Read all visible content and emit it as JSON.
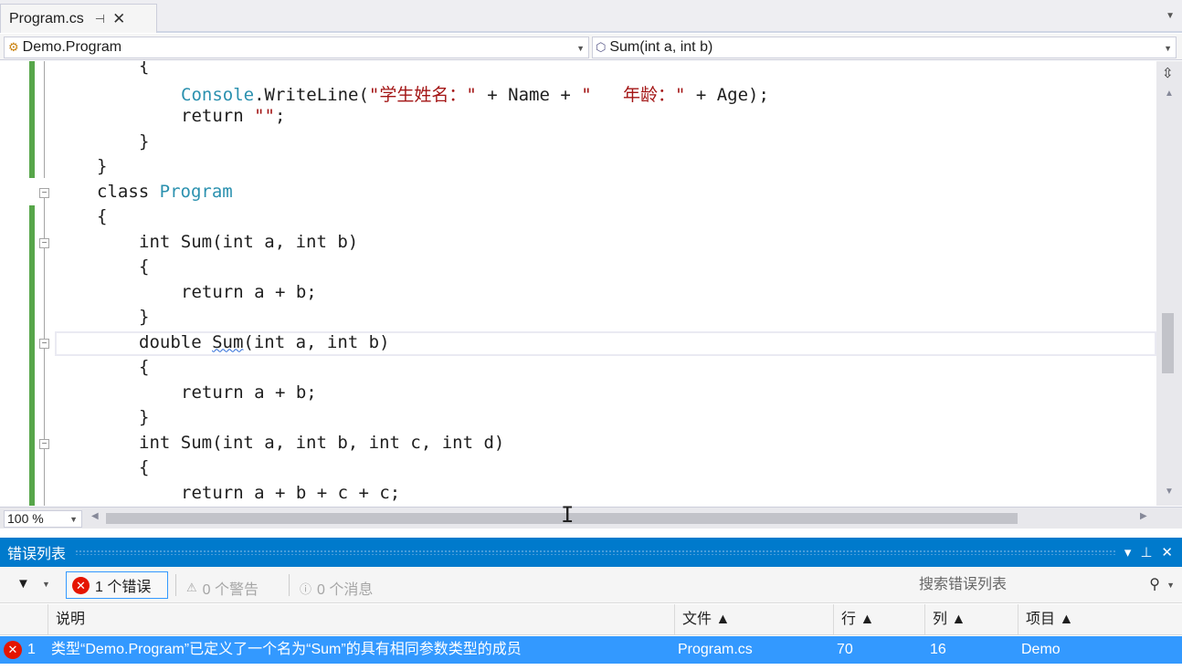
{
  "tab": {
    "label": "Program.cs",
    "pin": "⊣",
    "close": "✕"
  },
  "nav": {
    "class_combo": "Demo.Program",
    "member_combo": "Sum(int a, int b)"
  },
  "code_lines": [
    {
      "indent": 3,
      "parts": [
        {
          "t": "{",
          "c": "kw"
        }
      ]
    },
    {
      "indent": 4,
      "parts": [
        {
          "t": "Console",
          "c": "type"
        },
        {
          "t": ".WriteLine(",
          "c": "kw"
        },
        {
          "t": "\"学生姓名：\"",
          "c": "str"
        },
        {
          "t": " + Name + ",
          "c": "kw"
        },
        {
          "t": "\"   年龄：\"",
          "c": "str"
        },
        {
          "t": " + Age);",
          "c": "kw"
        }
      ]
    },
    {
      "indent": 4,
      "parts": [
        {
          "t": "return ",
          "c": "kw"
        },
        {
          "t": "\"\"",
          "c": "str"
        },
        {
          "t": ";",
          "c": "kw"
        }
      ]
    },
    {
      "indent": 3,
      "parts": [
        {
          "t": "}",
          "c": "kw"
        }
      ]
    },
    {
      "indent": 2,
      "parts": [
        {
          "t": "}",
          "c": "kw"
        }
      ]
    },
    {
      "indent": 2,
      "parts": [
        {
          "t": "class ",
          "c": "kw"
        },
        {
          "t": "Program",
          "c": "type"
        }
      ]
    },
    {
      "indent": 2,
      "parts": [
        {
          "t": "{",
          "c": "kw"
        }
      ]
    },
    {
      "indent": 3,
      "parts": [
        {
          "t": "int Sum(int a, int b)",
          "c": "kw"
        }
      ]
    },
    {
      "indent": 3,
      "parts": [
        {
          "t": "{",
          "c": "kw"
        }
      ]
    },
    {
      "indent": 4,
      "parts": [
        {
          "t": "return a + b;",
          "c": "kw"
        }
      ]
    },
    {
      "indent": 3,
      "parts": [
        {
          "t": "}",
          "c": "kw"
        }
      ]
    },
    {
      "indent": 3,
      "parts": [
        {
          "t": "double ",
          "c": "kw"
        },
        {
          "t": "Sum",
          "c": "squiggle"
        },
        {
          "t": "(int a, int b)",
          "c": "kw"
        }
      ]
    },
    {
      "indent": 3,
      "parts": [
        {
          "t": "{",
          "c": "kw"
        }
      ]
    },
    {
      "indent": 4,
      "parts": [
        {
          "t": "return a + b;",
          "c": "kw"
        }
      ]
    },
    {
      "indent": 3,
      "parts": [
        {
          "t": "}",
          "c": "kw"
        }
      ]
    },
    {
      "indent": 3,
      "parts": [
        {
          "t": "int Sum(int a, int b, int c, int d)",
          "c": "kw"
        }
      ]
    },
    {
      "indent": 3,
      "parts": [
        {
          "t": "{",
          "c": "kw"
        }
      ]
    },
    {
      "indent": 4,
      "parts": [
        {
          "t": "return a + b + c + c;",
          "c": "kw"
        }
      ]
    }
  ],
  "editor": {
    "zoom": "100 %"
  },
  "error_list": {
    "title": "错误列表",
    "errors_btn": "1 个错误",
    "warnings_btn": "0 个警告",
    "messages_btn": "0 个消息",
    "search_placeholder": "搜索错误列表",
    "columns": {
      "desc": "说明",
      "file": "文件 ▲",
      "line": "行 ▲",
      "col": "列 ▲",
      "project": "项目 ▲"
    },
    "rows": [
      {
        "num": "1",
        "desc": "类型“Demo.Program”已定义了一个名为“Sum”的具有相同参数类型的成员",
        "file": "Program.cs",
        "line": "70",
        "col": "16",
        "project": "Demo"
      }
    ]
  },
  "colors": {
    "accent": "#007acc",
    "selection": "#3399ff",
    "error": "#e51400",
    "type": "#2b91af",
    "string": "#a31515",
    "change_bar": "#57a64a"
  }
}
